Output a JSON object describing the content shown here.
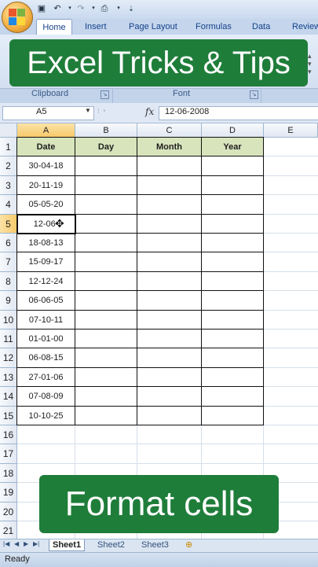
{
  "ribbon": {
    "tabs": [
      "Home",
      "Insert",
      "Page Layout",
      "Formulas",
      "Data",
      "Review"
    ],
    "groups": [
      "Clipboard",
      "Font"
    ]
  },
  "banners": {
    "top": "Excel Tricks & Tips",
    "bottom": "Format cells"
  },
  "formula_bar": {
    "name_box": "A5",
    "fx": "fx",
    "value": "12-06-2008"
  },
  "sheet": {
    "columns": [
      "A",
      "B",
      "C",
      "D",
      "E"
    ],
    "row_numbers": [
      "1",
      "2",
      "3",
      "4",
      "5",
      "6",
      "7",
      "8",
      "9",
      "10",
      "11",
      "12",
      "13",
      "14",
      "15",
      "16",
      "17",
      "18",
      "19",
      "20",
      "21"
    ],
    "table_headers": [
      "Date",
      "Day",
      "Month",
      "Year"
    ],
    "dates": [
      "30-04-18",
      "20-11-19",
      "05-05-20",
      "12-06-",
      "18-08-13",
      "15-09-17",
      "12-12-24",
      "06-06-05",
      "07-10-11",
      "01-01-00",
      "06-08-15",
      "27-01-06",
      "07-08-09",
      "10-10-25"
    ],
    "active_cell": "A5"
  },
  "sheet_tabs": [
    "Sheet1",
    "Sheet2",
    "Sheet3"
  ],
  "status": "Ready",
  "colors": {
    "banner": "#1f7d3a",
    "header_fill": "#d8e4bc",
    "selection": "#f7c96b"
  }
}
